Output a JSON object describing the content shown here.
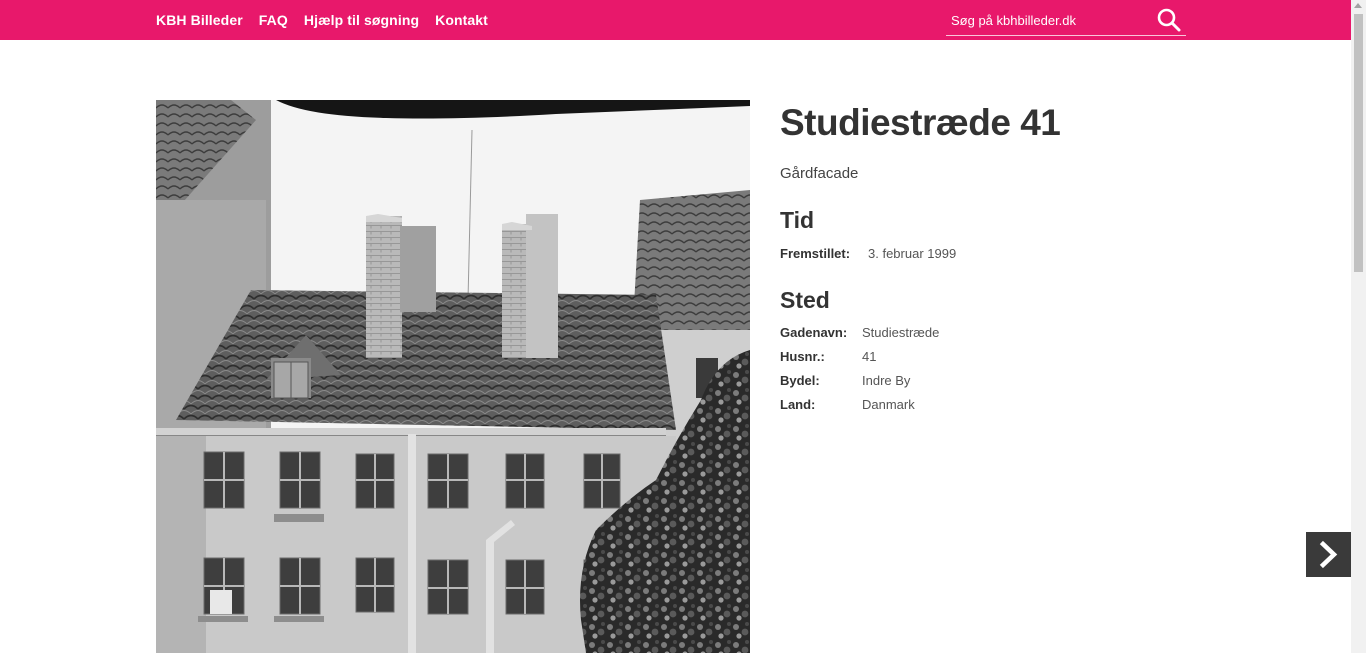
{
  "nav": {
    "items": [
      "KBH Billeder",
      "FAQ",
      "Hjælp til søgning",
      "Kontakt"
    ]
  },
  "search": {
    "placeholder": "Søg på kbhbilleder.dk",
    "icon": "search-icon"
  },
  "colors": {
    "brand": "#e8186b",
    "next_button": "#3a3a3a"
  },
  "record": {
    "title": "Studiestræde 41",
    "description": "Gårdfacade",
    "time_heading": "Tid",
    "time_fields": [
      {
        "label": "Fremstillet:",
        "value": "3. februar 1999"
      }
    ],
    "place_heading": "Sted",
    "place_fields": [
      {
        "label": "Gadenavn:",
        "value": "Studiestræde"
      },
      {
        "label": "Husnr.:",
        "value": "41"
      },
      {
        "label": "Bydel:",
        "value": "Indre By"
      },
      {
        "label": "Land:",
        "value": "Danmark"
      }
    ]
  },
  "next_button": {
    "icon": "chevron-right-icon"
  }
}
